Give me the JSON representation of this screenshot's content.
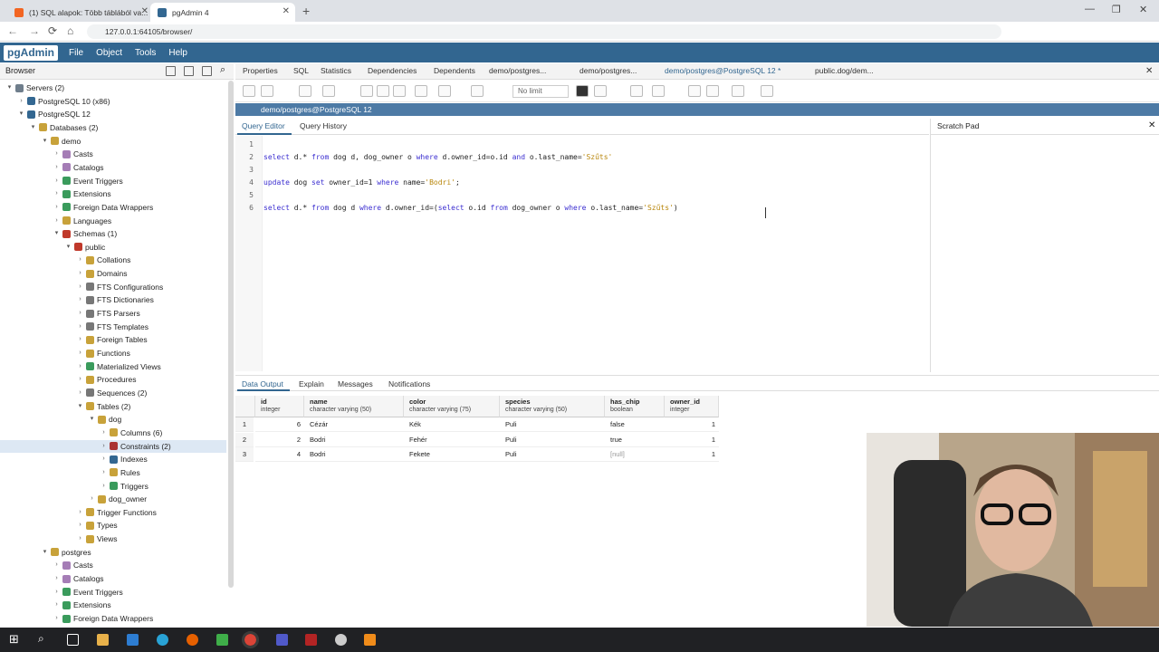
{
  "chrome": {
    "tabs": [
      {
        "title": "(1) SQL alapok: Több táblából va...",
        "active": false
      },
      {
        "title": "pgAdmin 4",
        "active": true
      }
    ],
    "url": "127.0.0.1:64105/browser/"
  },
  "menubar": {
    "logo": "pgAdmin",
    "items": [
      "File",
      "Object",
      "Tools",
      "Help"
    ]
  },
  "browser": {
    "title": "Browser",
    "tree": [
      {
        "label": "Servers (2)",
        "indent": 0,
        "open": true,
        "color": "#6f7e8c"
      },
      {
        "label": "PostgreSQL 10 (x86)",
        "indent": 1,
        "open": false,
        "color": "#336791"
      },
      {
        "label": "PostgreSQL 12",
        "indent": 1,
        "open": true,
        "color": "#336791"
      },
      {
        "label": "Databases (2)",
        "indent": 2,
        "open": true,
        "color": "#c8a23a"
      },
      {
        "label": "demo",
        "indent": 3,
        "open": true,
        "color": "#c8a23a"
      },
      {
        "label": "Casts",
        "indent": 4,
        "open": false,
        "color": "#a57db6"
      },
      {
        "label": "Catalogs",
        "indent": 4,
        "open": false,
        "color": "#a57db6"
      },
      {
        "label": "Event Triggers",
        "indent": 4,
        "open": false,
        "color": "#3a9b5c"
      },
      {
        "label": "Extensions",
        "indent": 4,
        "open": false,
        "color": "#3a9b5c"
      },
      {
        "label": "Foreign Data Wrappers",
        "indent": 4,
        "open": false,
        "color": "#3a9b5c"
      },
      {
        "label": "Languages",
        "indent": 4,
        "open": false,
        "color": "#c8a23a"
      },
      {
        "label": "Schemas (1)",
        "indent": 4,
        "open": true,
        "color": "#c0392b"
      },
      {
        "label": "public",
        "indent": 5,
        "open": true,
        "color": "#c0392b"
      },
      {
        "label": "Collations",
        "indent": 6,
        "open": false,
        "color": "#c8a23a"
      },
      {
        "label": "Domains",
        "indent": 6,
        "open": false,
        "color": "#c8a23a"
      },
      {
        "label": "FTS Configurations",
        "indent": 6,
        "open": false,
        "color": "#777"
      },
      {
        "label": "FTS Dictionaries",
        "indent": 6,
        "open": false,
        "color": "#777"
      },
      {
        "label": "FTS Parsers",
        "indent": 6,
        "open": false,
        "color": "#777"
      },
      {
        "label": "FTS Templates",
        "indent": 6,
        "open": false,
        "color": "#777"
      },
      {
        "label": "Foreign Tables",
        "indent": 6,
        "open": false,
        "color": "#c8a23a"
      },
      {
        "label": "Functions",
        "indent": 6,
        "open": false,
        "color": "#c8a23a"
      },
      {
        "label": "Materialized Views",
        "indent": 6,
        "open": false,
        "color": "#3a9b5c"
      },
      {
        "label": "Procedures",
        "indent": 6,
        "open": false,
        "color": "#c8a23a"
      },
      {
        "label": "Sequences (2)",
        "indent": 6,
        "open": false,
        "color": "#777"
      },
      {
        "label": "Tables (2)",
        "indent": 6,
        "open": true,
        "color": "#c8a23a"
      },
      {
        "label": "dog",
        "indent": 7,
        "open": true,
        "color": "#c8a23a"
      },
      {
        "label": "Columns (6)",
        "indent": 8,
        "open": false,
        "color": "#c8a23a"
      },
      {
        "label": "Constraints (2)",
        "indent": 8,
        "open": false,
        "color": "#a33",
        "selected": true
      },
      {
        "label": "Indexes",
        "indent": 8,
        "open": false,
        "color": "#336791"
      },
      {
        "label": "Rules",
        "indent": 8,
        "open": false,
        "color": "#c8a23a"
      },
      {
        "label": "Triggers",
        "indent": 8,
        "open": false,
        "color": "#3a9b5c"
      },
      {
        "label": "dog_owner",
        "indent": 7,
        "open": false,
        "color": "#c8a23a"
      },
      {
        "label": "Trigger Functions",
        "indent": 6,
        "open": false,
        "color": "#c8a23a"
      },
      {
        "label": "Types",
        "indent": 6,
        "open": false,
        "color": "#c8a23a"
      },
      {
        "label": "Views",
        "indent": 6,
        "open": false,
        "color": "#c8a23a"
      },
      {
        "label": "postgres",
        "indent": 3,
        "open": true,
        "color": "#c8a23a"
      },
      {
        "label": "Casts",
        "indent": 4,
        "open": false,
        "color": "#a57db6"
      },
      {
        "label": "Catalogs",
        "indent": 4,
        "open": false,
        "color": "#a57db6"
      },
      {
        "label": "Event Triggers",
        "indent": 4,
        "open": false,
        "color": "#3a9b5c"
      },
      {
        "label": "Extensions",
        "indent": 4,
        "open": false,
        "color": "#3a9b5c"
      },
      {
        "label": "Foreign Data Wrappers",
        "indent": 4,
        "open": false,
        "color": "#3a9b5c"
      }
    ]
  },
  "panel_tabs": [
    "Properties",
    "SQL",
    "Statistics",
    "Dependencies",
    "Dependents",
    "demo/postgres...",
    "demo/postgres...",
    "demo/postgres@PostgreSQL 12 *",
    "public.dog/dem..."
  ],
  "query": {
    "limit": "No limit",
    "title": "demo/postgres@PostgreSQL 12",
    "tabs": [
      "Query Editor",
      "Query History"
    ],
    "scratch_title": "Scratch Pad",
    "lines": [
      "",
      "select d.* from dog d, dog_owner o where d.owner_id=o.id and o.last_name='Szűts'",
      "",
      "update dog set owner_id=1 where name='Bodri';",
      "",
      "select d.* from dog d where d.owner_id=(select o.id from dog_owner o where o.last_name='Szűts')"
    ]
  },
  "output": {
    "tabs": [
      "Data Output",
      "Explain",
      "Messages",
      "Notifications"
    ],
    "columns": [
      {
        "name": "id",
        "type": "integer"
      },
      {
        "name": "name",
        "type": "character varying (50)"
      },
      {
        "name": "color",
        "type": "character varying (75)"
      },
      {
        "name": "species",
        "type": "character varying (50)"
      },
      {
        "name": "has_chip",
        "type": "boolean"
      },
      {
        "name": "owner_id",
        "type": "integer"
      }
    ],
    "rows": [
      {
        "n": "1",
        "cells": [
          "6",
          "Cézár",
          "Kék",
          "Puli",
          "false",
          "1"
        ]
      },
      {
        "n": "2",
        "cells": [
          "2",
          "Bodri",
          "Fehér",
          "Puli",
          "true",
          "1"
        ]
      },
      {
        "n": "3",
        "cells": [
          "4",
          "Bodri",
          "Fekete",
          "Puli",
          "[null]",
          "1"
        ]
      }
    ]
  }
}
